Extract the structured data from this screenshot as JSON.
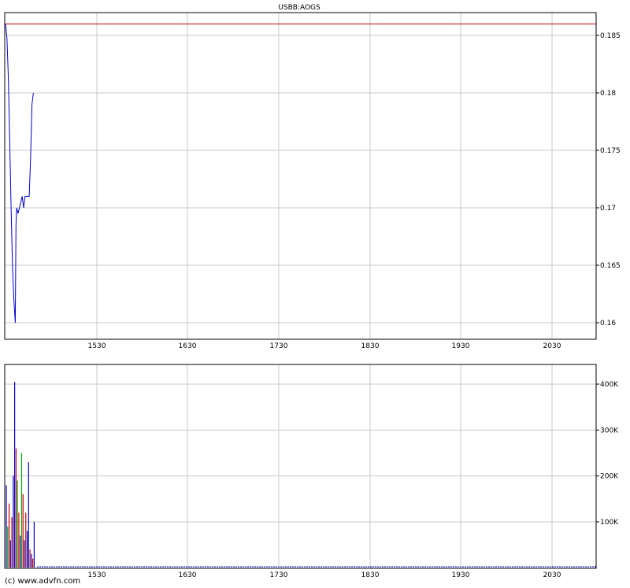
{
  "title": "USBB:AOGS",
  "footer": "(c) www.advfn.com",
  "colors": {
    "price_line": "#0000cc",
    "reference_line": "#cc0000",
    "volume_up": "#0000cc",
    "volume_down": "#cc0000",
    "volume_flat": "#00aa00",
    "grid": "#c8c8c8",
    "frame": "#000000"
  },
  "chart_data": [
    {
      "type": "line",
      "name": "price-panel",
      "x_ticks": [
        "1530",
        "1630",
        "1730",
        "1830",
        "1930",
        "2030"
      ],
      "y_ticks": [
        "0.185",
        "0.18",
        "0.175",
        "0.17",
        "0.165",
        "0.16"
      ],
      "y_tick_values": [
        0.185,
        0.18,
        0.175,
        0.17,
        0.165,
        0.16
      ],
      "ylim": [
        0.1585,
        0.187
      ],
      "reference_level": 0.186,
      "series": [
        {
          "points": [
            [
              0,
              0.186
            ],
            [
              1,
              0.1848
            ],
            [
              2,
              0.1815
            ],
            [
              3,
              0.176
            ],
            [
              4,
              0.17
            ],
            [
              5,
              0.165
            ],
            [
              6,
              0.162
            ],
            [
              7,
              0.16
            ],
            [
              7.5,
              0.1685
            ],
            [
              8,
              0.17
            ],
            [
              9,
              0.1695
            ],
            [
              10,
              0.17
            ],
            [
              11,
              0.1705
            ],
            [
              12,
              0.171
            ],
            [
              13,
              0.17
            ],
            [
              14,
              0.171
            ],
            [
              15,
              0.171
            ],
            [
              16,
              0.171
            ],
            [
              17,
              0.171
            ],
            [
              18,
              0.1745
            ],
            [
              19,
              0.179
            ],
            [
              20,
              0.18
            ]
          ]
        }
      ],
      "grid": true
    },
    {
      "type": "bar",
      "name": "volume-panel",
      "x_ticks": [
        "1530",
        "1630",
        "1730",
        "1830",
        "1930",
        "2030"
      ],
      "y_ticks": [
        "400K",
        "300K",
        "200K",
        "100K"
      ],
      "y_tick_values": [
        400000,
        300000,
        200000,
        100000
      ],
      "ylim": [
        0,
        440000
      ],
      "bars": [
        {
          "t": 0,
          "v": 180000,
          "c": "up"
        },
        {
          "t": 1,
          "v": 90000,
          "c": "flat"
        },
        {
          "t": 2,
          "v": 140000,
          "c": "down"
        },
        {
          "t": 3,
          "v": 60000,
          "c": "up"
        },
        {
          "t": 4,
          "v": 110000,
          "c": "down"
        },
        {
          "t": 5,
          "v": 200000,
          "c": "up"
        },
        {
          "t": 6,
          "v": 405000,
          "c": "up"
        },
        {
          "t": 7,
          "v": 260000,
          "c": "down"
        },
        {
          "t": 8,
          "v": 190000,
          "c": "flat"
        },
        {
          "t": 9,
          "v": 120000,
          "c": "down"
        },
        {
          "t": 10,
          "v": 70000,
          "c": "up"
        },
        {
          "t": 11,
          "v": 250000,
          "c": "flat"
        },
        {
          "t": 12,
          "v": 160000,
          "c": "down"
        },
        {
          "t": 13,
          "v": 60000,
          "c": "up"
        },
        {
          "t": 14,
          "v": 120000,
          "c": "down"
        },
        {
          "t": 15,
          "v": 80000,
          "c": "up"
        },
        {
          "t": 16,
          "v": 230000,
          "c": "up"
        },
        {
          "t": 17,
          "v": 40000,
          "c": "down"
        },
        {
          "t": 18,
          "v": 30000,
          "c": "up"
        },
        {
          "t": 19,
          "v": 20000,
          "c": "down"
        },
        {
          "t": 20,
          "v": 100000,
          "c": "up"
        }
      ],
      "baseline_volume": 4000,
      "grid": true
    }
  ]
}
